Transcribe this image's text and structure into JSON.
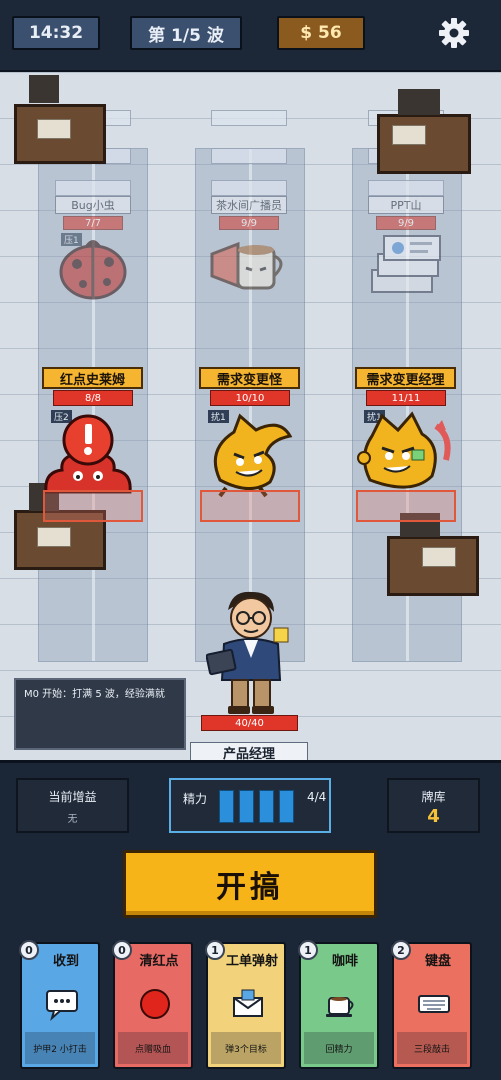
{
  "topbar": {
    "time": "14:32",
    "wave": "第 1/5 波",
    "money": "$ 56",
    "settings_icon": "gear-icon"
  },
  "back_enemies": [
    {
      "name": "Bug小虫",
      "hp": "7/7",
      "intent": "压1",
      "icon": "ladybug-icon"
    },
    {
      "name": "茶水间广播员",
      "hp": "9/9",
      "intent": "",
      "icon": "teacup-megaphone-icon"
    },
    {
      "name": "PPT山",
      "hp": "9/9",
      "intent": "",
      "icon": "ppt-stack-icon"
    }
  ],
  "front_enemies": [
    {
      "name": "红点史莱姆",
      "hp": "8/8",
      "intent": "压2",
      "icon": "red-dot-slime-icon"
    },
    {
      "name": "需求变更怪",
      "hp": "10/10",
      "intent": "扰1",
      "icon": "yellow-arrow-monster-icon"
    },
    {
      "name": "需求变更经理",
      "hp": "11/11",
      "intent": "扰1",
      "icon": "yellow-manager-monster-icon"
    }
  ],
  "hero": {
    "name": "产品经理",
    "hp": "40/40",
    "icon": "product-manager-avatar"
  },
  "log": {
    "text": "M0 开始：打满 5 波，经验满就"
  },
  "stats": {
    "buff_title": "当前增益",
    "buff_value": "无",
    "energy_label": "精力",
    "energy_current": 4,
    "energy_max": 4,
    "energy_count": "4/4",
    "deck_title": "牌库",
    "deck_count": "4"
  },
  "go_button": "开搞",
  "cards": [
    {
      "cost": "0",
      "name": "收到",
      "desc": "护甲2 小打击",
      "color": "#5aa7e6",
      "icon": "chat-bubble-icon"
    },
    {
      "cost": "0",
      "name": "清红点",
      "desc": "点赠吸血",
      "color": "#e86a64",
      "icon": "red-dot-icon"
    },
    {
      "cost": "1",
      "name": "工单弹射",
      "desc": "弹3个目标",
      "color": "#f2d27a",
      "icon": "ticket-envelope-icon"
    },
    {
      "cost": "1",
      "name": "咖啡",
      "desc": "回精力",
      "color": "#79c98a",
      "icon": "coffee-cup-icon"
    },
    {
      "cost": "2",
      "name": "键盘",
      "desc": "三段敲击",
      "color": "#ec7060",
      "icon": "keyboard-icon"
    }
  ],
  "colors": {
    "accent_gold": "#f7b418",
    "hp_red": "#e0362a",
    "energy_blue": "#2b8fdc"
  }
}
